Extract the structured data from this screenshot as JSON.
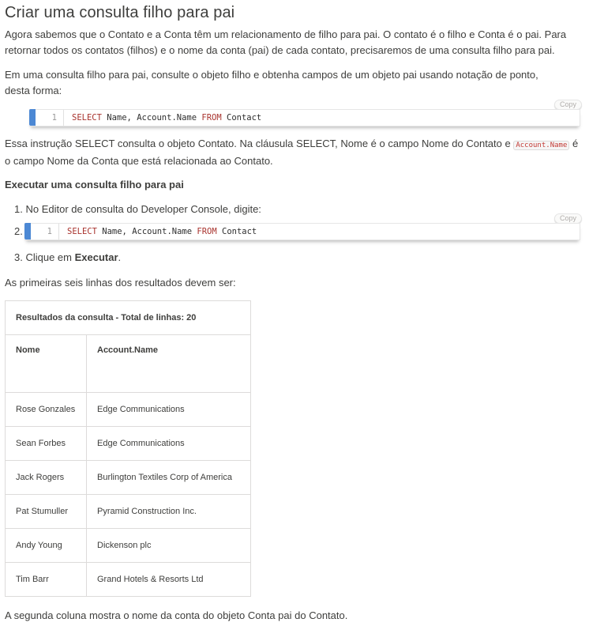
{
  "title": "Criar uma consulta filho para pai",
  "intro_line1": "Agora sabemos que o Contato e a Conta têm um relacionamento de filho para pai. O contato é o filho e Conta é o pai. Para",
  "intro_line2": "retornar todos os contatos (filhos) e o nome da conta (pai) de cada contato, precisaremos de uma consulta filho para pai.",
  "explain_line1": "Em uma consulta filho para pai, consulte o objeto filho e obtenha campos de um objeto pai usando notação de ponto,",
  "explain_line2": "desta forma:",
  "copy_label": "Copy",
  "code_block1": {
    "line_number": "1",
    "kw_select": "SELECT",
    "fields": " Name, Account.Name ",
    "kw_from": "FROM",
    "object": " Contact"
  },
  "statement_pre": "Essa instrução SELECT consulta o objeto Contato. Na cláusula SELECT, Nome é o campo Nome do Contato e",
  "statement_code": "Account.Name",
  "statement_post": "é",
  "statement_line2": "o campo Nome da Conta que está relacionada ao Contato.",
  "section_title": "Executar uma consulta filho para pai",
  "steps": {
    "s1_num": "1.",
    "s1_text": "No Editor de consulta do Developer Console, digite:",
    "s2_num": "2.",
    "s3_num": "3.",
    "s3_pre": "Clique em ",
    "s3_bold": "Executar",
    "s3_post": "."
  },
  "code_block2": {
    "line_number": "1",
    "kw_select": "SELECT",
    "fields": " Name, Account.Name ",
    "kw_from": "FROM",
    "object": " Contact"
  },
  "results_intro": "As primeiras seis linhas dos resultados devem ser:",
  "results_table": {
    "caption": "Resultados da consulta - Total de linhas: 20",
    "headers": [
      "Nome",
      "Account.Name"
    ],
    "rows": [
      [
        "Rose Gonzales",
        "Edge Communications"
      ],
      [
        "Sean Forbes",
        "Edge Communications"
      ],
      [
        "Jack Rogers",
        "Burlington Textiles Corp of America"
      ],
      [
        "Pat Stumuller",
        "Pyramid Construction Inc."
      ],
      [
        "Andy Young",
        "Dickenson plc"
      ],
      [
        "Tim Barr",
        "Grand Hotels & Resorts Ltd"
      ]
    ]
  },
  "closing": "A segunda coluna mostra o nome da conta do objeto Conta pai do Contato.",
  "colors": {
    "accent_bar": "#4c88d4",
    "keyword": "#a8322d",
    "inline_code": "#c23934"
  }
}
